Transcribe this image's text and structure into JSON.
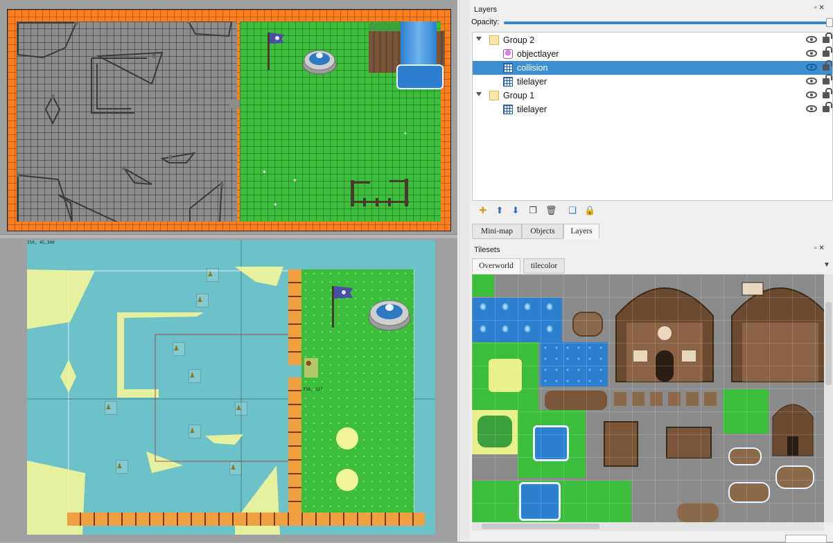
{
  "layers_panel": {
    "title": "Layers",
    "opacity_label": "Opacity:",
    "opacity_value": 1.0,
    "items": [
      {
        "label": "Group 2",
        "type": "group",
        "expanded": true,
        "visible": true,
        "locked": false,
        "selected": false
      },
      {
        "label": "objectlayer",
        "type": "object",
        "visible": true,
        "locked": false,
        "selected": false
      },
      {
        "label": "collision",
        "type": "tile",
        "visible": true,
        "locked": false,
        "selected": true
      },
      {
        "label": "tilelayer",
        "type": "tile",
        "visible": true,
        "locked": false,
        "selected": false
      },
      {
        "label": "Group 1",
        "type": "group",
        "expanded": true,
        "visible": true,
        "locked": false,
        "selected": false
      },
      {
        "label": "tilelayer",
        "type": "tile",
        "visible": true,
        "locked": false,
        "selected": false
      }
    ],
    "toolbar_icons": [
      "new-layer-icon",
      "raise-layer-icon",
      "lower-layer-icon",
      "duplicate-layer-icon",
      "remove-layer-icon",
      "toggle-others-icon",
      "lock-others-icon"
    ]
  },
  "dock_tabs": [
    {
      "label": "Mini-map",
      "active": false
    },
    {
      "label": "Objects",
      "active": false
    },
    {
      "label": "Layers",
      "active": true
    }
  ],
  "tilesets_panel": {
    "title": "Tilesets",
    "tabs": [
      {
        "label": "Overworld",
        "active": true
      },
      {
        "label": "tilecolor",
        "active": false
      }
    ]
  },
  "map_view": {
    "coords_text": "350, 45,300",
    "debug_text": "350, 327"
  },
  "colors": {
    "accent": "#3c8fd0",
    "collision_orange": "#ff7f1e",
    "grass": "#3cbd3c",
    "water_bg": "#6cc2c8",
    "collision_fill": "#f3f59a"
  }
}
